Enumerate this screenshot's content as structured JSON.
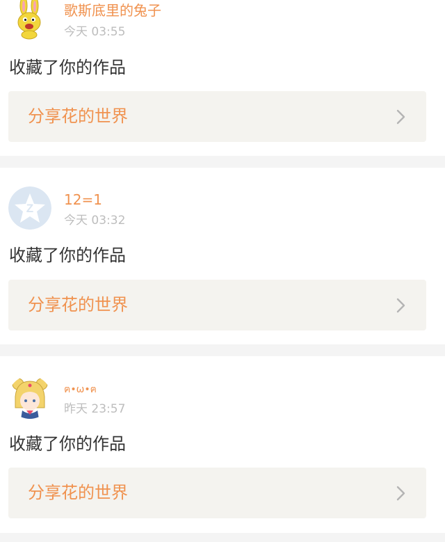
{
  "feed": {
    "items": [
      {
        "username": "歌斯底里的兔子",
        "time": "今天 03:55",
        "action": "收藏了你的作品",
        "work_title": "分享花的世界",
        "avatar_icon": "bunny-avatar-icon"
      },
      {
        "username": "12=1",
        "time": "今天 03:32",
        "action": "收藏了你的作品",
        "work_title": "分享花的世界",
        "avatar_icon": "qzone-star-avatar-icon"
      },
      {
        "username": "ฅ•ω•ฅ",
        "time": "昨天 23:57",
        "action": "收藏了你的作品",
        "work_title": "分享花的世界",
        "avatar_icon": "sailor-moon-avatar-icon"
      }
    ]
  },
  "colors": {
    "accent": "#f0924f",
    "muted_text": "#bdbdbd",
    "primary_text": "#333333",
    "link_background": "#f4f3ef",
    "divider": "#f4f4f4"
  }
}
